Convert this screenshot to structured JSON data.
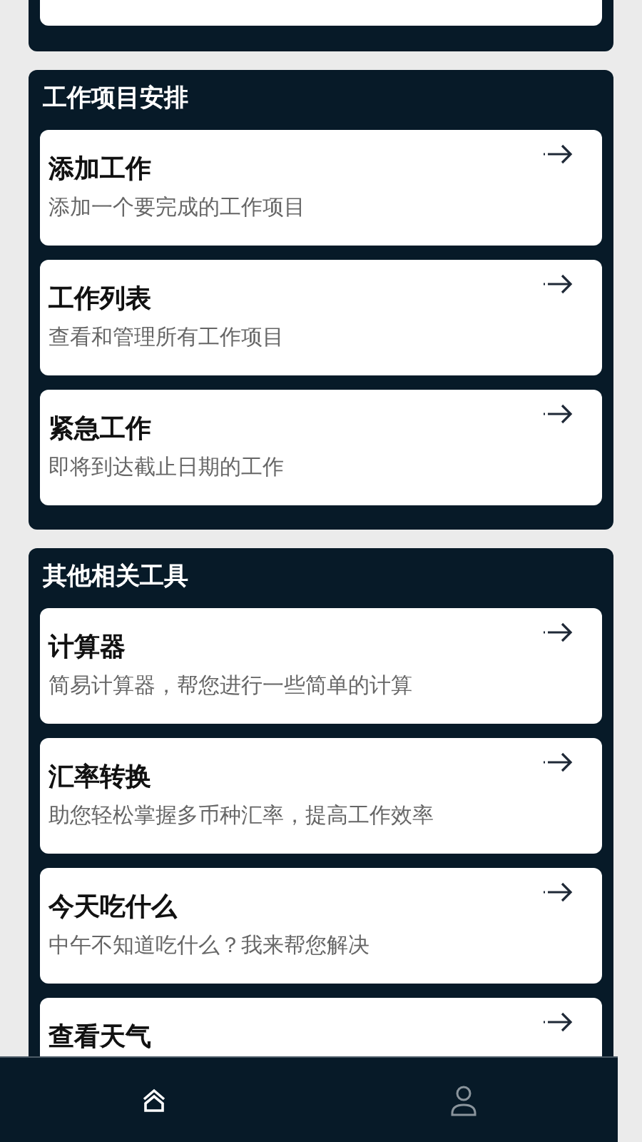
{
  "sections": [
    {
      "title": "工作项目安排",
      "items": [
        {
          "title": "添加工作",
          "description": "添加一个要完成的工作项目"
        },
        {
          "title": "工作列表",
          "description": "查看和管理所有工作项目"
        },
        {
          "title": "紧急工作",
          "description": "即将到达截止日期的工作"
        }
      ]
    },
    {
      "title": "其他相关工具",
      "items": [
        {
          "title": "计算器",
          "description": "简易计算器，帮您进行一些简单的计算"
        },
        {
          "title": "汇率转换",
          "description": "助您轻松掌握多币种汇率，提高工作效率"
        },
        {
          "title": "今天吃什么",
          "description": "中午不知道吃什么？我来帮您解决"
        },
        {
          "title": "查看天气"
        }
      ]
    }
  ],
  "bottom_nav": [
    {
      "kind": "home",
      "selected": true
    },
    {
      "kind": "profile",
      "selected": false
    }
  ]
}
